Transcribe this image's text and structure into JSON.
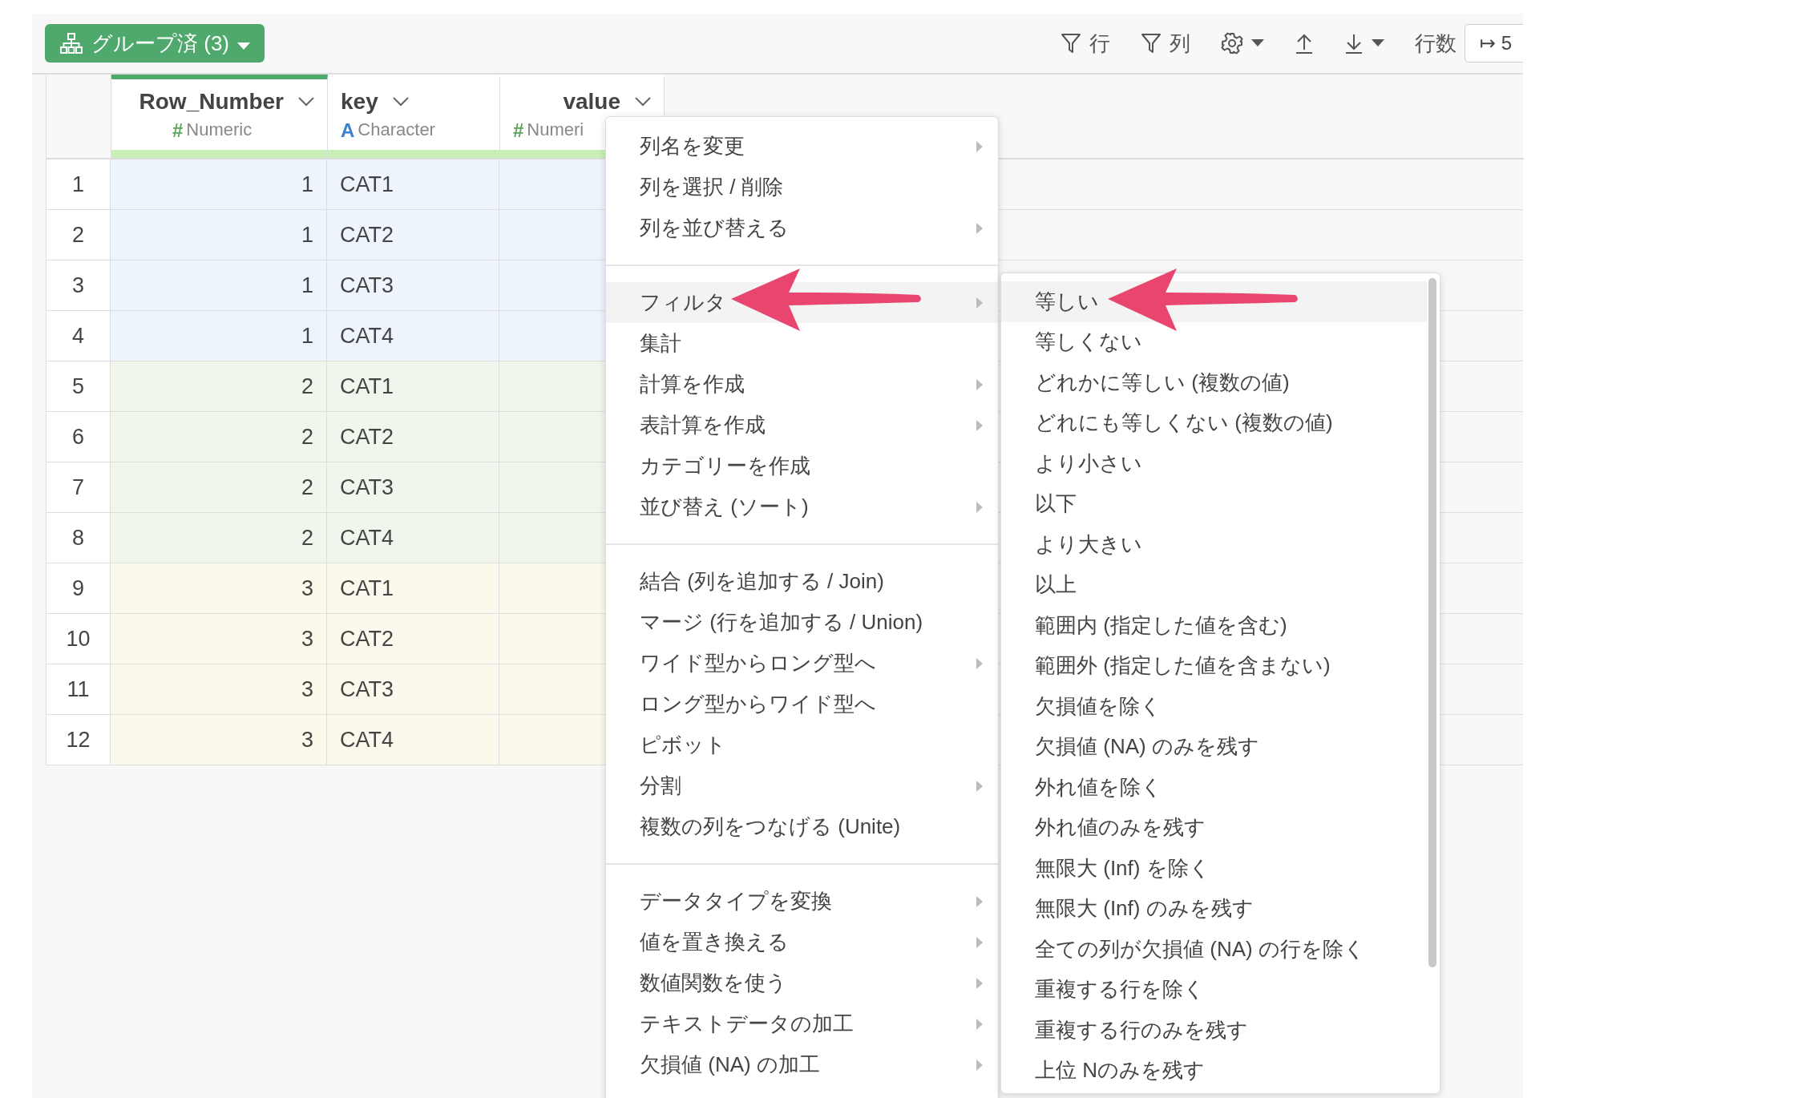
{
  "toolbar": {
    "group_button": "グループ済 (3)",
    "items": [
      {
        "kind": "filter",
        "label": "行"
      },
      {
        "kind": "filter",
        "label": "列"
      },
      {
        "kind": "gear"
      },
      {
        "kind": "upload"
      },
      {
        "kind": "download"
      }
    ],
    "row_count_label": "行数",
    "row_count_value": "↦ 5"
  },
  "table": {
    "columns": [
      {
        "name": "Row_Number",
        "type_icon": "#",
        "type": "Numeric",
        "kind": "numeric",
        "selected": true
      },
      {
        "name": "key",
        "type_icon": "A",
        "type": "Character",
        "kind": "character",
        "selected": false
      },
      {
        "name": "value",
        "type_icon": "#",
        "type": "Numeri",
        "kind": "numeric",
        "selected": false
      }
    ],
    "rows": [
      {
        "number": "1",
        "cells": [
          "1",
          "CAT1"
        ],
        "color": "#eef4fc"
      },
      {
        "number": "2",
        "cells": [
          "1",
          "CAT2"
        ],
        "color": "#eef4fc"
      },
      {
        "number": "3",
        "cells": [
          "1",
          "CAT3"
        ],
        "color": "#eef4fc"
      },
      {
        "number": "4",
        "cells": [
          "1",
          "CAT4"
        ],
        "color": "#eef4fc"
      },
      {
        "number": "5",
        "cells": [
          "2",
          "CAT1"
        ],
        "color": "#f1f6ec"
      },
      {
        "number": "6",
        "cells": [
          "2",
          "CAT2"
        ],
        "color": "#f1f6ec"
      },
      {
        "number": "7",
        "cells": [
          "2",
          "CAT3"
        ],
        "color": "#f1f6ec"
      },
      {
        "number": "8",
        "cells": [
          "2",
          "CAT4"
        ],
        "color": "#f1f6ec"
      },
      {
        "number": "9",
        "cells": [
          "3",
          "CAT1"
        ],
        "color": "#fbf9ec"
      },
      {
        "number": "10",
        "cells": [
          "3",
          "CAT2"
        ],
        "color": "#fbf9ec"
      },
      {
        "number": "11",
        "cells": [
          "3",
          "CAT3"
        ],
        "color": "#fbf9ec"
      },
      {
        "number": "12",
        "cells": [
          "3",
          "CAT4"
        ],
        "color": "#fbf9ec"
      }
    ]
  },
  "context_menu": {
    "sections": [
      [
        {
          "label": "列名を変更",
          "has_submenu": true,
          "selected": false
        },
        {
          "label": "列を選択 / 削除",
          "has_submenu": false,
          "selected": false
        },
        {
          "label": "列を並び替える",
          "has_submenu": true,
          "selected": false
        }
      ],
      [
        {
          "label": "フィルタ",
          "has_submenu": true,
          "selected": true
        },
        {
          "label": "集計",
          "has_submenu": false,
          "selected": false
        },
        {
          "label": "計算を作成",
          "has_submenu": true,
          "selected": false
        },
        {
          "label": "表計算を作成",
          "has_submenu": true,
          "selected": false
        },
        {
          "label": "カテゴリーを作成",
          "has_submenu": false,
          "selected": false
        },
        {
          "label": "並び替え (ソート)",
          "has_submenu": true,
          "selected": false
        }
      ],
      [
        {
          "label": "結合 (列を追加する / Join)",
          "has_submenu": false,
          "selected": false
        },
        {
          "label": "マージ (行を追加する / Union)",
          "has_submenu": false,
          "selected": false
        },
        {
          "label": "ワイド型からロング型へ",
          "has_submenu": true,
          "selected": false
        },
        {
          "label": "ロング型からワイド型へ",
          "has_submenu": false,
          "selected": false
        },
        {
          "label": "ピボット",
          "has_submenu": false,
          "selected": false
        },
        {
          "label": "分割",
          "has_submenu": true,
          "selected": false
        },
        {
          "label": "複数の列をつなげる (Unite)",
          "has_submenu": false,
          "selected": false
        }
      ],
      [
        {
          "label": "データタイプを変換",
          "has_submenu": true,
          "selected": false
        },
        {
          "label": "値を置き換える",
          "has_submenu": true,
          "selected": false
        },
        {
          "label": "数値関数を使う",
          "has_submenu": true,
          "selected": false
        },
        {
          "label": "テキストデータの加工",
          "has_submenu": true,
          "selected": false
        },
        {
          "label": "欠損値 (NA) の加工",
          "has_submenu": true,
          "selected": false
        }
      ]
    ]
  },
  "filter_submenu": {
    "items": [
      {
        "label": "等しい",
        "selected": true
      },
      {
        "label": "等しくない",
        "selected": false
      },
      {
        "label": "どれかに等しい (複数の値)",
        "selected": false
      },
      {
        "label": "どれにも等しくない (複数の値)",
        "selected": false
      },
      {
        "label": "より小さい",
        "selected": false
      },
      {
        "label": "以下",
        "selected": false
      },
      {
        "label": "より大きい",
        "selected": false
      },
      {
        "label": "以上",
        "selected": false
      },
      {
        "label": "範囲内 (指定した値を含む)",
        "selected": false
      },
      {
        "label": "範囲外 (指定した値を含まない)",
        "selected": false
      },
      {
        "label": "欠損値を除く",
        "selected": false
      },
      {
        "label": "欠損値 (NA) のみを残す",
        "selected": false
      },
      {
        "label": "外れ値を除く",
        "selected": false
      },
      {
        "label": "外れ値のみを残す",
        "selected": false
      },
      {
        "label": "無限大 (Inf) を除く",
        "selected": false
      },
      {
        "label": "無限大 (Inf) のみを残す",
        "selected": false
      },
      {
        "label": "全ての列が欠損値 (NA) の行を除く",
        "selected": false
      },
      {
        "label": "重複する行を除く",
        "selected": false
      },
      {
        "label": "重複する行のみを残す",
        "selected": false
      },
      {
        "label": "上位 Nのみを残す",
        "selected": false
      }
    ]
  }
}
